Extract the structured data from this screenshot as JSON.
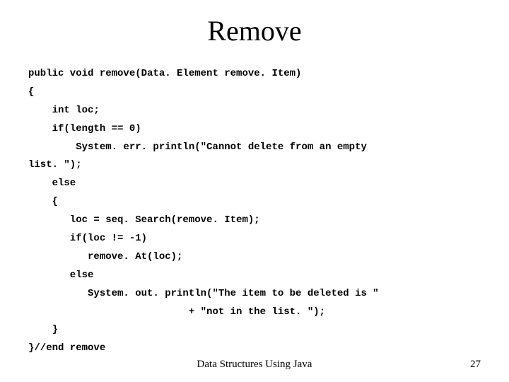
{
  "title": "Remove",
  "code": {
    "l1": "public void remove(Data. Element remove. Item)",
    "l2": "{",
    "l3": "    int loc;",
    "l4": "    if(length == 0)",
    "l5": "        System. err. println(\"Cannot delete from an empty",
    "l6": "list. \");",
    "l7": "    else",
    "l8": "    {",
    "l9": "       loc = seq. Search(remove. Item);",
    "l10": "       if(loc != -1)",
    "l11": "          remove. At(loc);",
    "l12": "       else",
    "l13": "          System. out. println(\"The item to be deleted is \"",
    "l14": "                           + \"not in the list. \");",
    "l15": "    }",
    "l16": "}//end remove"
  },
  "footer": "Data Structures Using Java",
  "page": "27"
}
